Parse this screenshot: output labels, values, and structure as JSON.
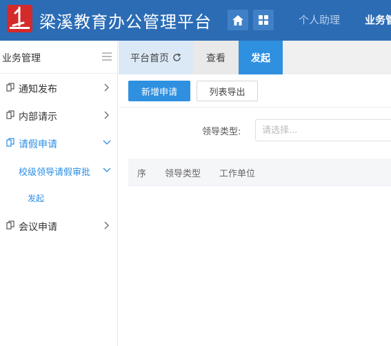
{
  "header": {
    "app_title": "梁溪教育办公管理平台",
    "home_icon": "home-icon",
    "apps_icon": "grid-icon",
    "nav": {
      "assistant": "个人助理",
      "business": "业务管"
    }
  },
  "sidebar": {
    "title": "业务管理",
    "items": [
      {
        "label": "通知发布",
        "icon": "document-icon",
        "arrow": "chevron-right-icon"
      },
      {
        "label": "内部请示",
        "icon": "document-icon",
        "arrow": "chevron-right-icon"
      },
      {
        "label": "请假申请",
        "icon": "document-icon",
        "arrow": "chevron-down-icon"
      },
      {
        "label": "校级领导请假审批",
        "arrow": "chevron-down-icon"
      },
      {
        "label": "发起"
      },
      {
        "label": "会议申请",
        "icon": "document-icon",
        "arrow": "chevron-right-icon"
      }
    ]
  },
  "tabs": {
    "home": "平台首页",
    "view": "查看",
    "start": "发起"
  },
  "toolbar": {
    "add_label": "新增申请",
    "export_label": "列表导出"
  },
  "filter": {
    "label": "领导类型:",
    "placeholder": "请选择..."
  },
  "table": {
    "columns": [
      "序",
      "领导类型",
      "工作单位"
    ]
  },
  "colors": {
    "header_bg": "#2b6cb5",
    "accent": "#2f90e0",
    "logo_red": "#d42a2a"
  }
}
